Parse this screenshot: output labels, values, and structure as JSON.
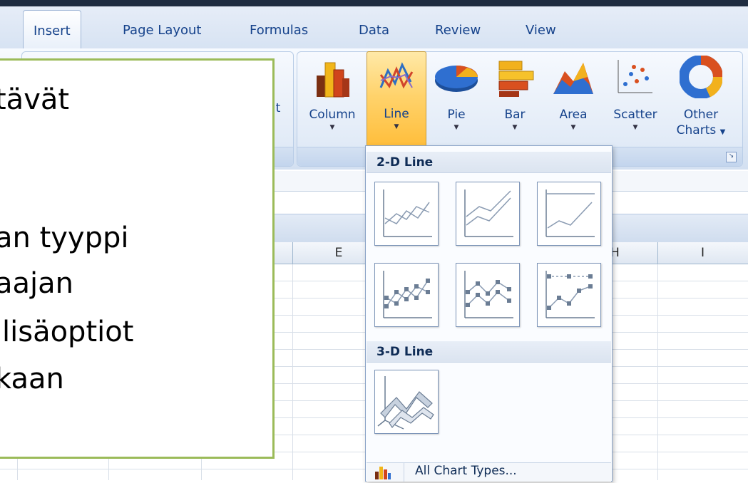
{
  "ribbon": {
    "tabs": [
      "Insert",
      "Page Layout",
      "Formulas",
      "Data",
      "Review",
      "View"
    ],
    "active_tab": "Insert",
    "partial_label": "t",
    "chart_buttons": [
      {
        "label": "Column",
        "icon": "column-chart-icon"
      },
      {
        "label": "Line",
        "icon": "line-chart-icon"
      },
      {
        "label": "Pie",
        "icon": "pie-chart-icon"
      },
      {
        "label": "Bar",
        "icon": "bar-chart-icon"
      },
      {
        "label": "Area",
        "icon": "area-chart-icon"
      },
      {
        "label": "Scatter",
        "icon": "scatter-chart-icon"
      },
      {
        "label": "Other",
        "label2": "Charts",
        "icon": "other-charts-icon"
      }
    ]
  },
  "sheet": {
    "columns": [
      "E",
      "H",
      "I"
    ]
  },
  "gallery": {
    "section_2d": "2-D Line",
    "section_3d": "3-D Line",
    "all_chart_types": "All Chart Types..."
  },
  "slide": {
    "lines": [
      "tävät",
      "an tyyppi",
      "aajan",
      "lisäoptiot",
      "kaan"
    ]
  },
  "colors": {
    "ribbon_text": "#15428b",
    "active_button": "#ffd36c",
    "slide_border": "#9bbb59"
  }
}
